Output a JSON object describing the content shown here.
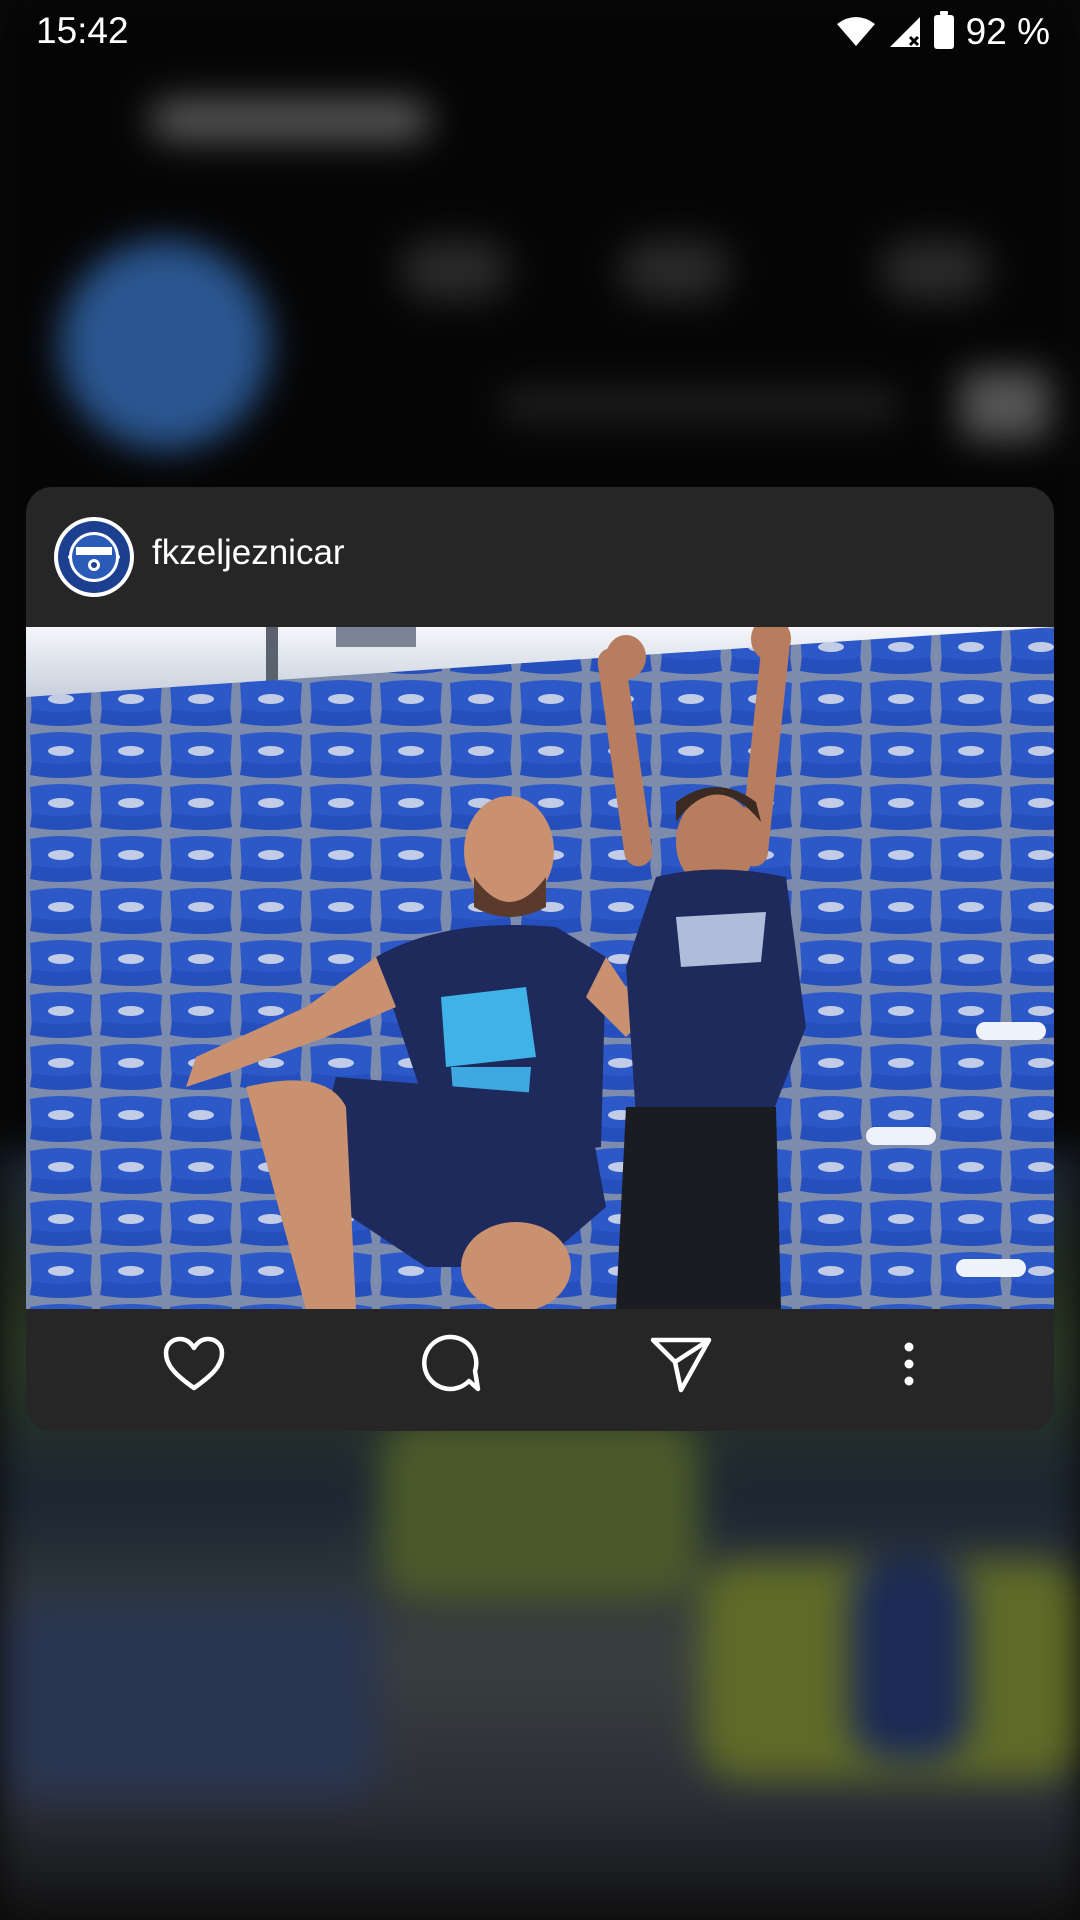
{
  "status_bar": {
    "time": "15:42",
    "battery_percent": "92 %",
    "icons": [
      "wifi-icon",
      "signal-icon",
      "battery-icon"
    ]
  },
  "preview": {
    "username": "fkzeljeznicar",
    "avatar_icon": "club-crest-icon",
    "photo_description_icon": "post-photo",
    "actions": [
      {
        "name": "like-button",
        "icon": "heart-icon"
      },
      {
        "name": "comment-button",
        "icon": "comment-icon"
      },
      {
        "name": "share-button",
        "icon": "send-icon"
      },
      {
        "name": "more-options-button",
        "icon": "more-vertical-icon"
      }
    ]
  },
  "colors": {
    "card_background": "#262626",
    "text_primary": "#ffffff",
    "seat_blue": "#2f5fd0",
    "shirt_navy": "#1e2a5c"
  }
}
